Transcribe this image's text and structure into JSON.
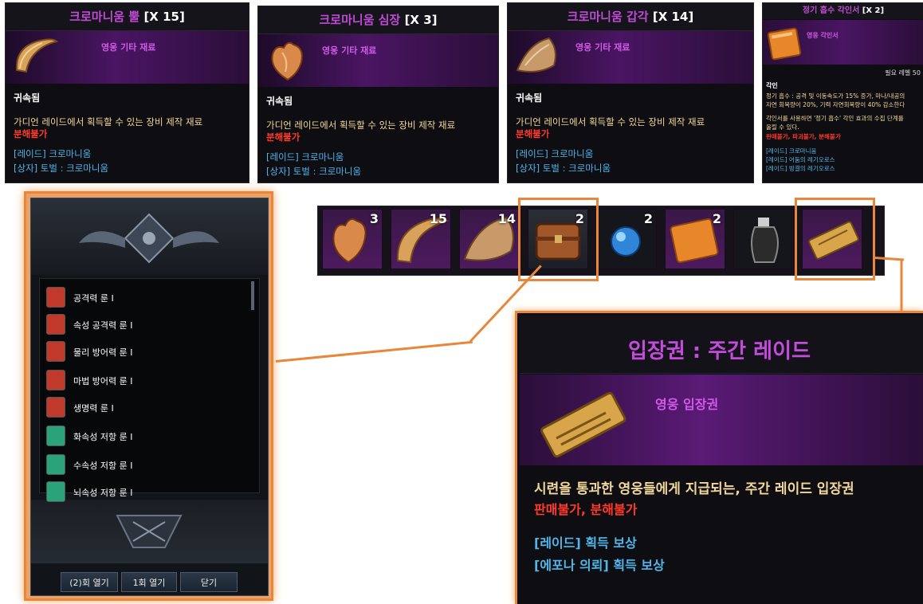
{
  "tooltips": [
    {
      "name": "크로마니움 뿔",
      "count": "[X 15]",
      "grade": "영웅 기타 재료",
      "bound": "귀속됨",
      "description": "가디언 레이드에서 획득할 수 있는 장비 제작 재료",
      "restriction": "분해불가",
      "source_raid": "[레이드] 크로마니움",
      "source_box": "[상자] 토벌 : 크로마니움"
    },
    {
      "name": "크로마니움 심장",
      "count": "[X 3]",
      "grade": "영웅 기타 재료",
      "bound": "귀속됨",
      "description": "가디언 레이드에서 획득할 수 있는 장비 제작 재료",
      "restriction": "분해불가",
      "source_raid": "[레이드] 크로마니움",
      "source_box": "[상자] 토벌 : 크로마니움"
    },
    {
      "name": "크로마니움 갑각",
      "count": "[X 14]",
      "grade": "영웅 기타 재료",
      "bound": "귀속됨",
      "description": "가디언 레이드에서 획득할 수 있는 장비 제작 재료",
      "restriction": "분해불가",
      "source_raid": "[레이드] 크로마니움",
      "source_box": "[상자] 토벌 : 크로마니움"
    }
  ],
  "engraving_tooltip": {
    "name": "정기 흡수 각인서",
    "count": "[X 2]",
    "grade": "영웅 각인서",
    "level_req": "필요 레벨 50",
    "section": "각인",
    "effect_line1": "정기 흡수 : 공격 및 이동속도가 15% 증가, 마나/내공의",
    "effect_line2": "자연 회복량이 20%, 기력 자연회복량이 40% 감소한다",
    "use_line1": "각인서를 사용하면 '정기 흡수' 각인 효과의 수집 단계를",
    "use_line2": "올릴 수 있다.",
    "restriction": "판매불가, 파괴불가, 분해불가",
    "src1": "[레이드] 크로마니움",
    "src2": "[레이드] 어둠의 레기오로스",
    "src3": "[레이드] 빙결의 레기오로스"
  },
  "inventory": {
    "slots": [
      {
        "icon": "heart-icon",
        "count": "3"
      },
      {
        "icon": "horn-icon",
        "count": "15"
      },
      {
        "icon": "shell-icon",
        "count": "14"
      },
      {
        "icon": "chest-icon",
        "count": "2"
      },
      {
        "icon": "orb-icon",
        "count": "2"
      },
      {
        "icon": "book-icon",
        "count": "2"
      },
      {
        "icon": "potion-icon",
        "count": ""
      },
      {
        "icon": "ticket-icon",
        "count": ""
      }
    ]
  },
  "chest_panel": {
    "runes": [
      {
        "label": "공격력 룬 Ⅰ",
        "color": "#c0392b"
      },
      {
        "label": "속성 공격력 룬 Ⅰ",
        "color": "#c0392b"
      },
      {
        "label": "물리 방어력 룬 Ⅰ",
        "color": "#c0392b"
      },
      {
        "label": "마법 방어력 룬 Ⅰ",
        "color": "#c0392b"
      },
      {
        "label": "생명력 룬 Ⅰ",
        "color": "#c0392b"
      },
      {
        "label": "화속성 저항 룬 Ⅰ",
        "color": "#2aa37a"
      },
      {
        "label": "수속성 저항 룬 Ⅰ",
        "color": "#2aa37a"
      },
      {
        "label": "뇌속성 저항 룬 Ⅰ",
        "color": "#2aa37a"
      }
    ],
    "buttons": {
      "open_multi": "(2)회 열기",
      "open_once": "1회 열기",
      "close": "닫기"
    }
  },
  "ticket_tooltip": {
    "title": "입장권 : 주간 레이드",
    "grade": "영웅 입장권",
    "description": "시련을 통과한 영웅들에게 지급되는, 주간 레이드 입장권",
    "restriction": "판매불가, 분해불가",
    "src1": "[레이드] 획득 보상",
    "src2": "[에포나 의뢰] 획득 보상"
  },
  "colors": {
    "highlight": "#e9863a",
    "epic": "#c04ad6",
    "red": "#ff3a2a",
    "blue": "#4fb6ea"
  }
}
